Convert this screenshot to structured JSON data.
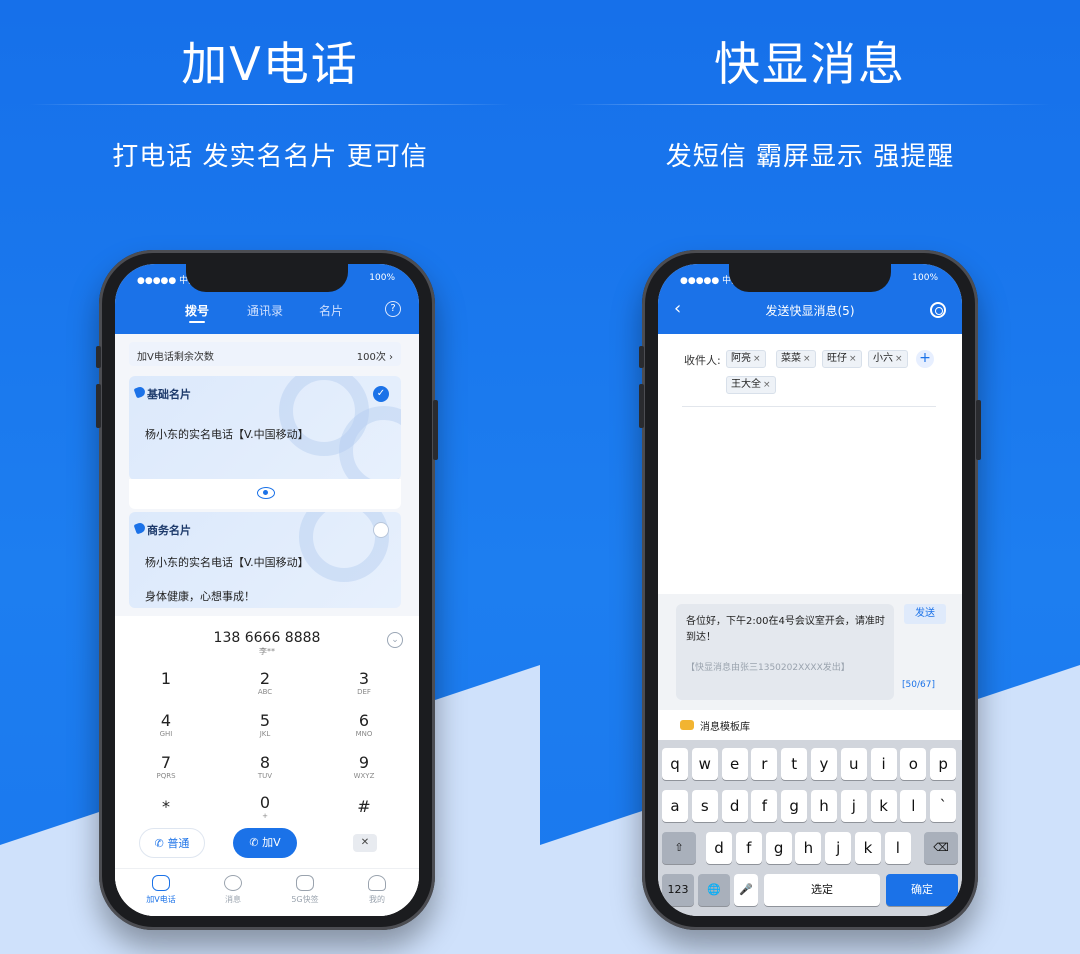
{
  "colors": {
    "brand_blue": "#1b72e8",
    "background_blue": "#1a78ee",
    "light_blue": "#cfe1fb"
  },
  "left": {
    "title": "加V电话",
    "subtitle": "打电话 发实名名片 更可信",
    "status": {
      "carrier": "●●●●● 中国移",
      "battery": "100%"
    },
    "tabs": [
      "拨号",
      "通讯录",
      "名片"
    ],
    "help_icon": "?",
    "remain": {
      "label": "加V电话剩余次数",
      "value": "100次 ›"
    },
    "cards": [
      {
        "tag": "基础名片",
        "line1": "杨小东的实名电话【V.中国移动】",
        "line2": "",
        "selected_mark": "✓"
      },
      {
        "tag": "商务名片",
        "line1": "杨小东的实名电话【V.中国移动】",
        "line2": "身体健康，心想事成！"
      }
    ],
    "dialer": {
      "number": "138 6666 8888",
      "name": "李**",
      "collapse_icon": "⌄",
      "keys": [
        {
          "d": "1",
          "s": ""
        },
        {
          "d": "2",
          "s": "ABC"
        },
        {
          "d": "3",
          "s": "DEF"
        },
        {
          "d": "4",
          "s": "GHI"
        },
        {
          "d": "5",
          "s": "JKL"
        },
        {
          "d": "6",
          "s": "MNO"
        },
        {
          "d": "7",
          "s": "PQRS"
        },
        {
          "d": "8",
          "s": "TUV"
        },
        {
          "d": "9",
          "s": "WXYZ"
        },
        {
          "d": "*",
          "s": ""
        },
        {
          "d": "0",
          "s": "+"
        },
        {
          "d": "#",
          "s": ""
        }
      ],
      "normal_call": "普通",
      "v_call": "加V",
      "clear_icon": "✕"
    },
    "nav": [
      "加V电话",
      "消息",
      "5G快签",
      "我的"
    ]
  },
  "right": {
    "title": "快显消息",
    "subtitle": "发短信 霸屏显示 强提醒",
    "status": {
      "carrier": "●●●●● 中国移",
      "battery": "100%"
    },
    "navbar_title": "发送快显消息(5)",
    "back_icon": "‹",
    "recipient_label": "收件人:",
    "recipients": [
      "阿亮",
      "菜菜",
      "旺仔",
      "小六",
      "王大全"
    ],
    "chip_remove": "×",
    "add_icon": "+",
    "message": "各位好，下午2:00在4号会议室开会，请准时到达！",
    "signature": "【快显消息由张三1350202XXXX发出】",
    "send": "发送",
    "counter": "[50/67]",
    "template_label": "消息模板库",
    "keyboard": {
      "row1": [
        "q",
        "w",
        "e",
        "r",
        "t",
        "y",
        "u",
        "i",
        "o",
        "p"
      ],
      "row2": [
        "a",
        "s",
        "d",
        "f",
        "g",
        "h",
        "j",
        "k",
        "l",
        "`"
      ],
      "row3": [
        "d",
        "f",
        "g",
        "h",
        "j",
        "k",
        "l"
      ],
      "shift": "⇧",
      "delete": "⌫",
      "num": "123",
      "globe": "🌐",
      "mic": "🎤",
      "space": "选定",
      "confirm": "确定"
    }
  }
}
